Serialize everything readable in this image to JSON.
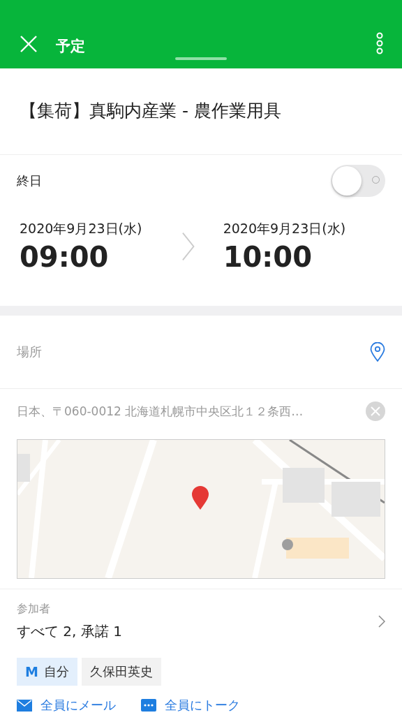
{
  "header": {
    "title": "予定"
  },
  "event": {
    "title": "【集荷】真駒内産業 - 農作業用具"
  },
  "all_day": {
    "label": "終日",
    "on": false
  },
  "start": {
    "date": "2020年9月23日(水)",
    "time": "09:00"
  },
  "end": {
    "date": "2020年9月23日(水)",
    "time": "10:00"
  },
  "location": {
    "label": "場所",
    "address": "日本、〒060-0012 北海道札幌市中央区北１２条西…"
  },
  "participants": {
    "label": "参加者",
    "summary": "すべて 2, 承諾 1",
    "chips": [
      {
        "kind": "self",
        "tag": "M",
        "name": "自分"
      },
      {
        "kind": "member",
        "name": "久保田英史"
      }
    ]
  },
  "actions": [
    {
      "kind": "mail",
      "label": "全員にメール"
    },
    {
      "kind": "talk",
      "label": "全員にトーク"
    }
  ]
}
